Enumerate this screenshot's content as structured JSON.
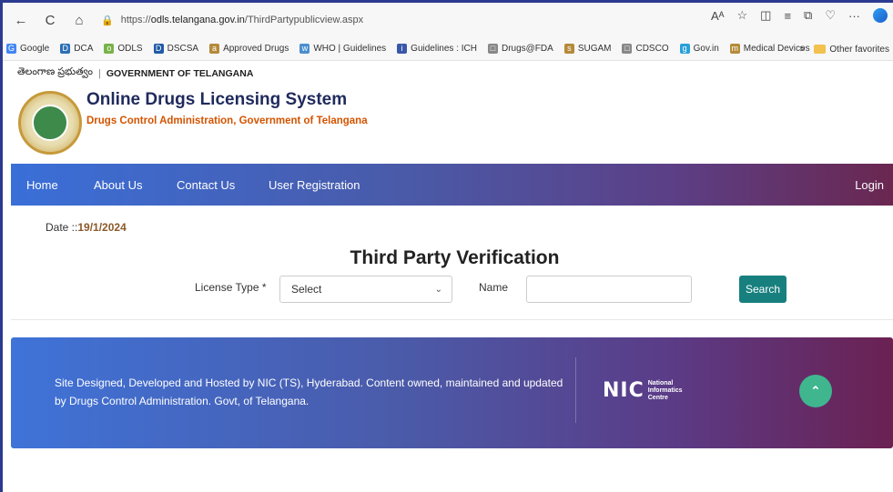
{
  "browser": {
    "back": "←",
    "reload": "C",
    "home": "⌂",
    "lock": "🔒",
    "url_prefix": "https://",
    "url_host": "odls.telangana.gov.in",
    "url_path": "/ThirdPartypublicview.aspx",
    "more": "···"
  },
  "favorites": [
    {
      "label": "Google",
      "icon": "G",
      "color": "#4285f4"
    },
    {
      "label": "DCA",
      "icon": "D",
      "color": "#2d6fb5"
    },
    {
      "label": "ODLS",
      "icon": "o",
      "color": "#78b24a"
    },
    {
      "label": "DSCSA",
      "icon": "D",
      "color": "#1f5aa5"
    },
    {
      "label": "Approved Drugs",
      "icon": "a",
      "color": "#b48a3a"
    },
    {
      "label": "WHO | Guidelines",
      "icon": "w",
      "color": "#4a8fd0"
    },
    {
      "label": "Guidelines : ICH",
      "icon": "i",
      "color": "#3a58a8"
    },
    {
      "label": "Drugs@FDA",
      "icon": "□",
      "color": "#888888"
    },
    {
      "label": "SUGAM",
      "icon": "s",
      "color": "#b48a3a"
    },
    {
      "label": "CDSCO",
      "icon": "□",
      "color": "#888888"
    },
    {
      "label": "Gov.in",
      "icon": "g",
      "color": "#2aa0d8"
    },
    {
      "label": "Medical Devices",
      "icon": "m",
      "color": "#b48a3a"
    }
  ],
  "favorites_more": ">",
  "other_favorites": "Other favorites",
  "header": {
    "telugu": "తెలంగాణ ప్రభుత్వం",
    "separator": "|",
    "government": "GOVERNMENT OF TELANGANA",
    "title": "Online Drugs Licensing System",
    "subtitle": "Drugs Control Administration, Government of Telangana"
  },
  "nav": {
    "home": "Home",
    "about": "About Us",
    "contact": "Contact Us",
    "registration": "User Registration",
    "login": "Login"
  },
  "content": {
    "date_label": "Date ::",
    "date_value": "19/1/2024",
    "title": "Third Party Verification",
    "license_label": "License Type *",
    "license_selected": "Select",
    "name_label": "Name",
    "name_value": "",
    "search_label": "Search"
  },
  "footer": {
    "text": "Site Designed, Developed and Hosted by NIC (TS), Hyderabad. Content owned, maintained and updated by Drugs Control Administration. Govt, of Telangana.",
    "nic_mark": "NIC",
    "nic_line1": "National",
    "nic_line2": "Informatics",
    "nic_line3": "Centre",
    "scroll_top": "⌃"
  }
}
